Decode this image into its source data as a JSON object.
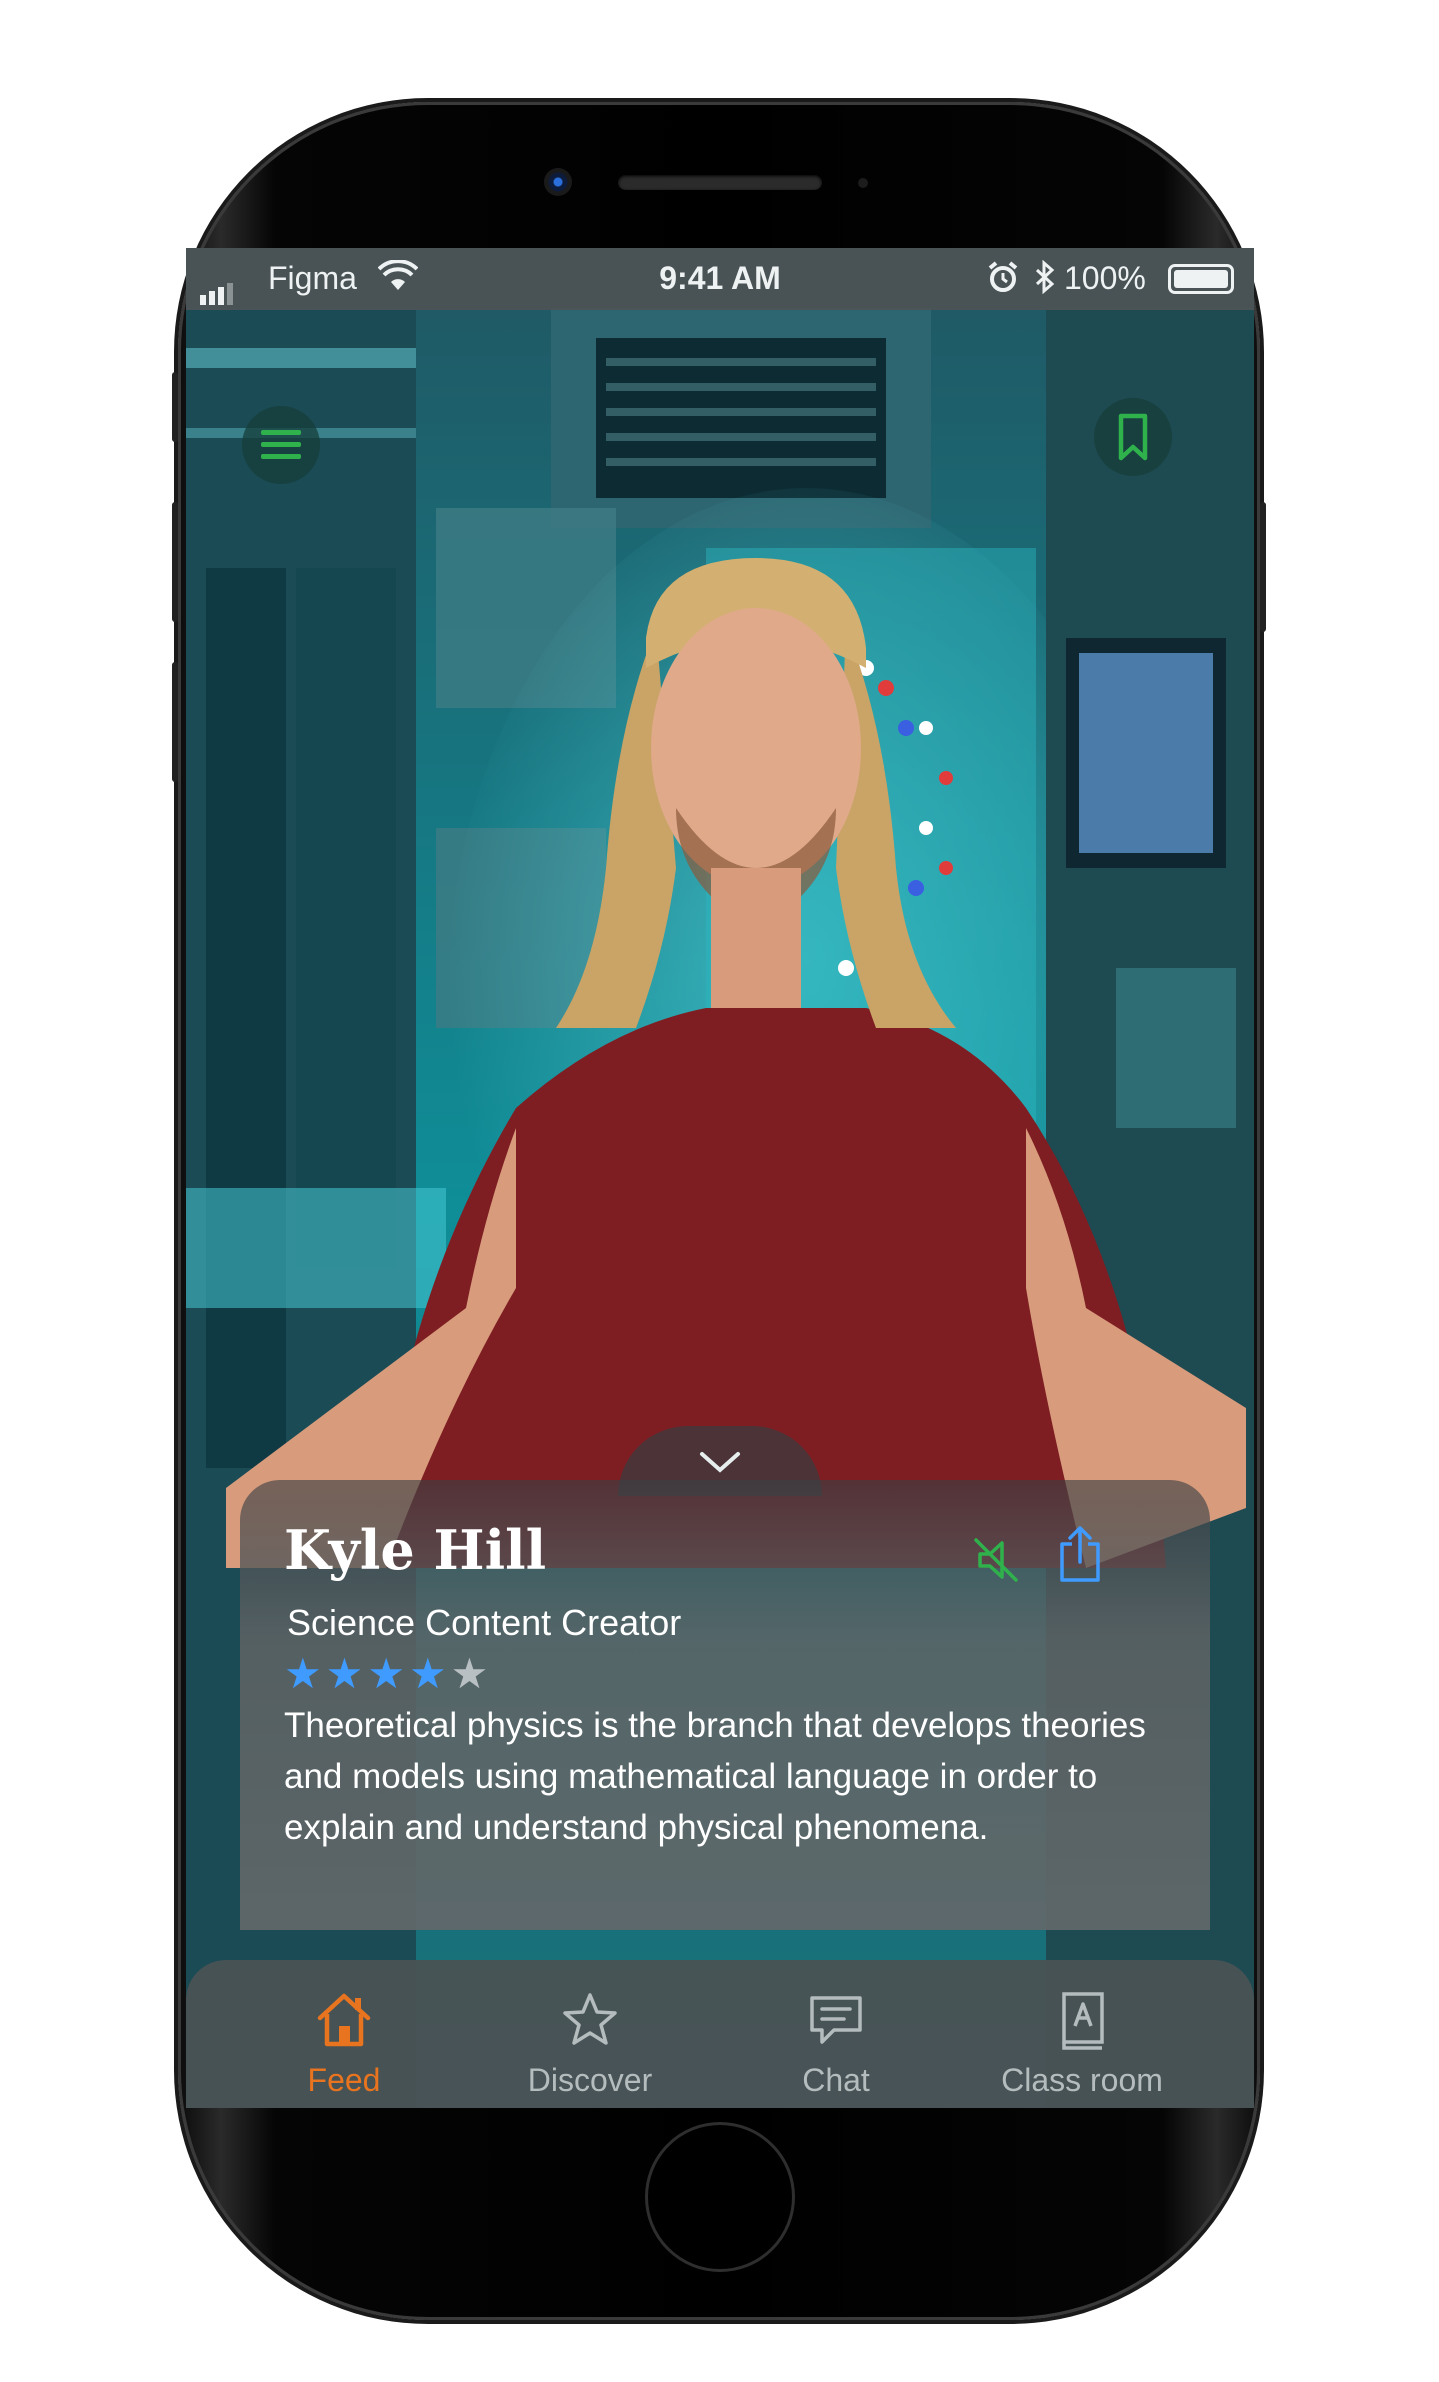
{
  "status_bar": {
    "carrier": "Figma",
    "time": "9:41 AM",
    "battery": "100%"
  },
  "profile": {
    "name": "Kyle Hill",
    "role": "Science Content Creator",
    "rating": 4,
    "rating_max": 5,
    "description": "Theoretical physics is the branch that develops theories and models using mathematical language in order to explain and understand physical phenomena."
  },
  "tabs": [
    {
      "label": "Feed",
      "icon": "home-icon",
      "active": true
    },
    {
      "label": "Discover",
      "icon": "star-icon",
      "active": false
    },
    {
      "label": "Chat",
      "icon": "chat-bubble-icon",
      "active": false
    },
    {
      "label": "Class room",
      "icon": "book-icon",
      "active": false
    }
  ],
  "colors": {
    "accent_active_tab": "#e8741f",
    "rating_star": "#3f9bff",
    "menu_icon": "#2fb24c",
    "share_icon": "#3f9bff"
  }
}
